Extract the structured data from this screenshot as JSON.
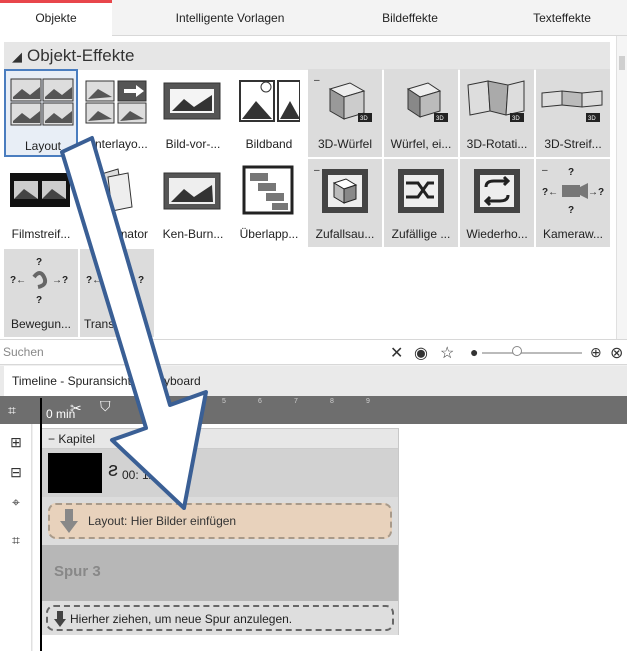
{
  "top_tabs": [
    "Objekte",
    "Intelligente Vorlagen",
    "Bildeffekte",
    "Texteffekte"
  ],
  "section": {
    "title": "Objekt-Effekte"
  },
  "tiles": [
    {
      "label": "Layout"
    },
    {
      "label": "Unterlayo..."
    },
    {
      "label": "Bild-vor-..."
    },
    {
      "label": "Bildband"
    },
    {
      "label": "3D-Würfel"
    },
    {
      "label": "Würfel, ei..."
    },
    {
      "label": "3D-Rotati..."
    },
    {
      "label": "3D-Streif..."
    },
    {
      "label": "Filmstreif..."
    },
    {
      "label": "mator"
    },
    {
      "label": "Ken-Burn..."
    },
    {
      "label": "Überlapp..."
    },
    {
      "label": "Zufallsau..."
    },
    {
      "label": "Zufällige ..."
    },
    {
      "label": "Wiederho..."
    },
    {
      "label": "Kameraw..."
    },
    {
      "label": "Bewegun..."
    },
    {
      "label": "Transp"
    }
  ],
  "search": {
    "placeholder": "Suchen"
  },
  "timeline_tabs": [
    "Timeline - Spuransicht",
    "ryboard"
  ],
  "ruler": {
    "mins": "0 min",
    "ticks": [
      "4",
      "5",
      "6",
      "7",
      "8",
      "9"
    ]
  },
  "tracks": {
    "kapitel": "Kapitel",
    "image_label": "00:    1x1.gif",
    "layout_label": "Layout: Hier Bilder einfügen",
    "spur3": "Spur 3",
    "hint": "Hierher ziehen, um neue Spur anzulegen."
  },
  "colors": {
    "active_tab": "#e8464b",
    "selected_tile": "#4a7dbf",
    "layout_track": "#e8d2bc",
    "arrow": "#ffffff"
  }
}
